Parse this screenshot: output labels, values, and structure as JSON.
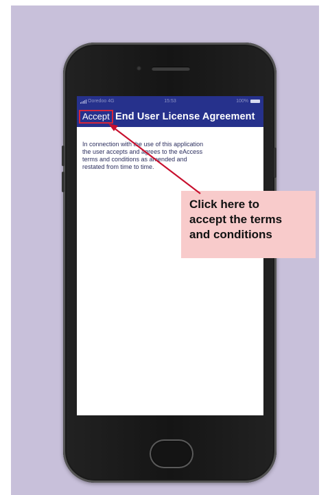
{
  "status_bar": {
    "carrier": "Ooredoo",
    "network": "4G",
    "time": "15:53",
    "battery": "100%",
    "icons": [
      "signal-icon",
      "battery-icon"
    ]
  },
  "nav": {
    "accept_label": "Accept",
    "title": "End User License Agreement"
  },
  "content": {
    "lines": [
      "In connection with the use of this application",
      "the user accepts and agrees to the eAccess",
      "terms and conditions as amended and",
      "restated from time to time."
    ]
  },
  "callout": {
    "lines": [
      "Click here to",
      "accept the terms",
      "and conditions"
    ]
  },
  "colors": {
    "background_panel": "#c8c0da",
    "nav_bar": "#26318c",
    "highlight_border": "#d8263a",
    "callout_bg": "#f8cbcb",
    "arrow": "#c8102e"
  }
}
